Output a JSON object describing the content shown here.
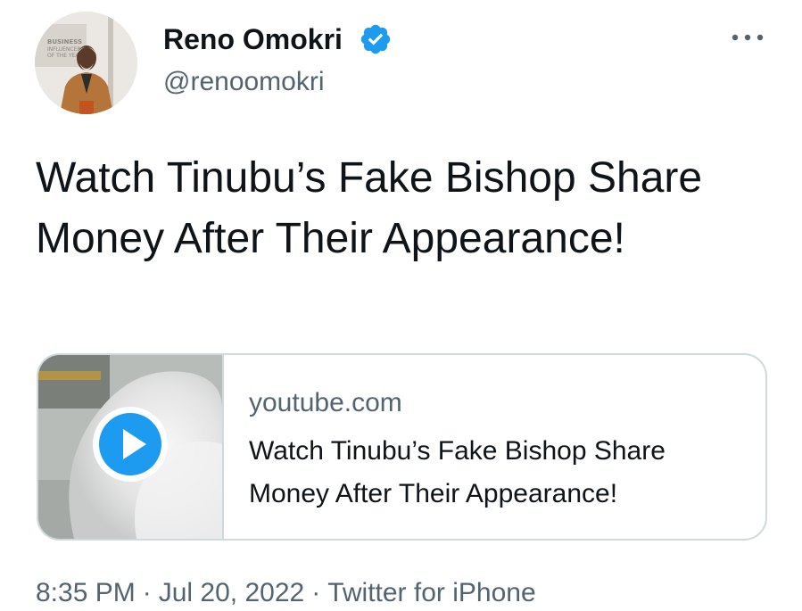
{
  "author": {
    "display_name": "Reno Omokri",
    "handle": "@renoomokri",
    "verified": true,
    "avatar_backdrop_text": [
      "BUSINESS",
      "INFLUENCER",
      "OF THE YEAR"
    ]
  },
  "tweet": {
    "text": "Watch Tinubu’s Fake Bishop Share Money After Their Appearance!"
  },
  "link_card": {
    "domain": "youtube.com",
    "title": "Watch Tinubu’s Fake Bishop Share Money After Their Appearance!",
    "play_icon": "play-circle-icon"
  },
  "meta": {
    "time": "8:35 PM",
    "date": "Jul 20, 2022",
    "separator": "·",
    "source": "Twitter for iPhone"
  },
  "colors": {
    "text_primary": "#0f1419",
    "text_secondary": "#536471",
    "border": "#cfd9de",
    "verified_badge": "#1d9bf0",
    "play_button": "#1d9bf0"
  },
  "icons": {
    "verified": "verified-badge-icon",
    "more": "more-options-icon"
  }
}
